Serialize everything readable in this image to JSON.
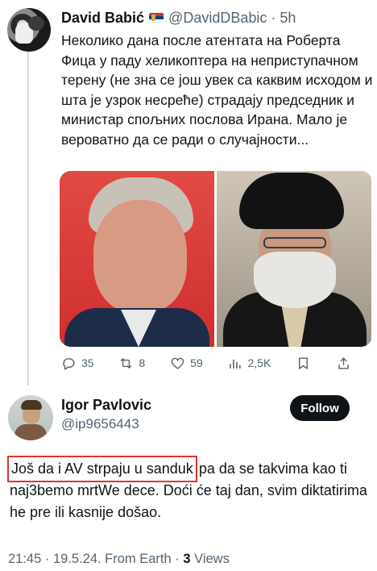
{
  "tweet": {
    "author_name": "David Babić",
    "handle_time": "@DavidDBabic · 5h",
    "text": "Неколико дана после атентата на Роберта Фица у паду хеликоптера на неприступачном терену (не зна се још увек са каквим исходом и шта је узрок несреће) страдају председник и министар спољних послова Ирана. Мало је вероватно да се ради о случајности...",
    "actions": {
      "replies": "35",
      "reposts": "8",
      "likes": "59",
      "views": "2,5K"
    }
  },
  "reply": {
    "author_name": "Igor Pavlovic",
    "handle": "@ip9656443",
    "follow_label": "Follow",
    "text_highlighted": "Još da i AV strpaju u sanduk",
    "text_rest": " pa da se takvima kao ti naj3bemo mrtWe dece. Doći će taj dan, svim diktatirima he pre ili kasnije došao.",
    "meta_prefix": "21:45 · 19.5.24. From Earth · ",
    "views_count": "3",
    "views_label": " Views"
  },
  "icons": {
    "reply": "reply-icon",
    "repost": "repost-icon",
    "like": "heart-icon",
    "views": "views-icon",
    "bookmark": "bookmark-icon",
    "share": "share-icon"
  },
  "colors": {
    "text": "#0f1419",
    "secondary": "#536471",
    "highlight_border": "#e0322c",
    "follow_bg": "#0f1419"
  }
}
